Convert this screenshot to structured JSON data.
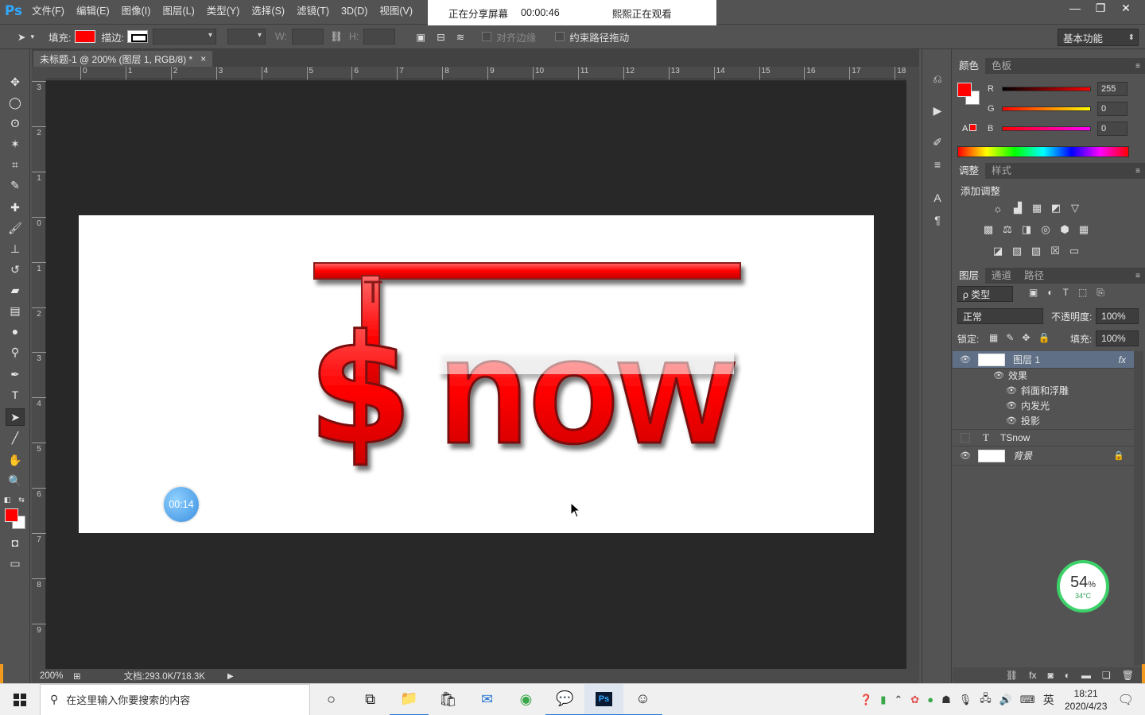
{
  "app": {
    "logo": "Ps",
    "menu": [
      "文件(F)",
      "编辑(E)",
      "图像(I)",
      "图层(L)",
      "类型(Y)",
      "选择(S)",
      "滤镜(T)",
      "3D(D)",
      "视图(V)"
    ],
    "window_controls": [
      "—",
      "❐",
      "✕"
    ]
  },
  "share_bar": {
    "status": "正在分享屏幕",
    "elapsed": "00:00:46",
    "watcher": "熙熙正在观看"
  },
  "options": {
    "fill_label": "填充:",
    "stroke_label": "描边:",
    "w_label": "W:",
    "h_label": "H:",
    "align_edges": "对齐边缘",
    "constrain_path": "约束路径拖动",
    "workspace": "基本功能",
    "fill_color": "#ff0000"
  },
  "document": {
    "tab_title": "未标题-1 @ 200% (图层 1, RGB/8) *",
    "tab_close": "×",
    "zoom": "200%",
    "doc_info": "文档:293.0K/718.3K",
    "ruler_h": [
      "0",
      "1",
      "2",
      "3",
      "4",
      "5",
      "6",
      "7",
      "8",
      "9",
      "10",
      "11",
      "12",
      "13",
      "14",
      "15",
      "16",
      "17",
      "18"
    ],
    "ruler_v": [
      "3",
      "2",
      "1",
      "0",
      "1",
      "2",
      "3",
      "4",
      "5",
      "6",
      "7",
      "8",
      "9"
    ],
    "canvas_text": {
      "first": "T",
      "dollar": "$",
      "rest": "now"
    }
  },
  "overlay": {
    "recording_timer": "00:14"
  },
  "color_panel": {
    "tabs": [
      "颜色",
      "色板"
    ],
    "channels": [
      {
        "label": "R",
        "value": "255"
      },
      {
        "label": "G",
        "value": "0"
      },
      {
        "label": "B",
        "value": "0"
      }
    ],
    "foreground": "#ff0000",
    "background": "#ffffff"
  },
  "adjustments_panel": {
    "tabs": [
      "调整",
      "样式"
    ],
    "title": "添加调整"
  },
  "layers_panel": {
    "tabs": [
      "图层",
      "通道",
      "路径"
    ],
    "filter_kind": "ρ 类型",
    "blend_mode": "正常",
    "opacity_label": "不透明度:",
    "opacity_value": "100%",
    "lock_label": "锁定:",
    "fill_label": "填充:",
    "fill_value": "100%",
    "layers": [
      {
        "name": "图层 1",
        "visible": true,
        "selected": true,
        "fx": "fx"
      },
      {
        "name": "TSnow",
        "visible": false,
        "type_glyph": "T"
      },
      {
        "name": "背景",
        "visible": true,
        "locked": true
      }
    ],
    "effects_label": "效果",
    "effects": [
      "斜面和浮雕",
      "内发光",
      "投影"
    ]
  },
  "perf_widget": {
    "percent": "54",
    "percent_sign": "%",
    "temp": "34°C"
  },
  "taskbar": {
    "search_placeholder": "在这里输入你要搜索的内容",
    "ime": "英",
    "time": "18:21",
    "date": "2020/4/23"
  }
}
